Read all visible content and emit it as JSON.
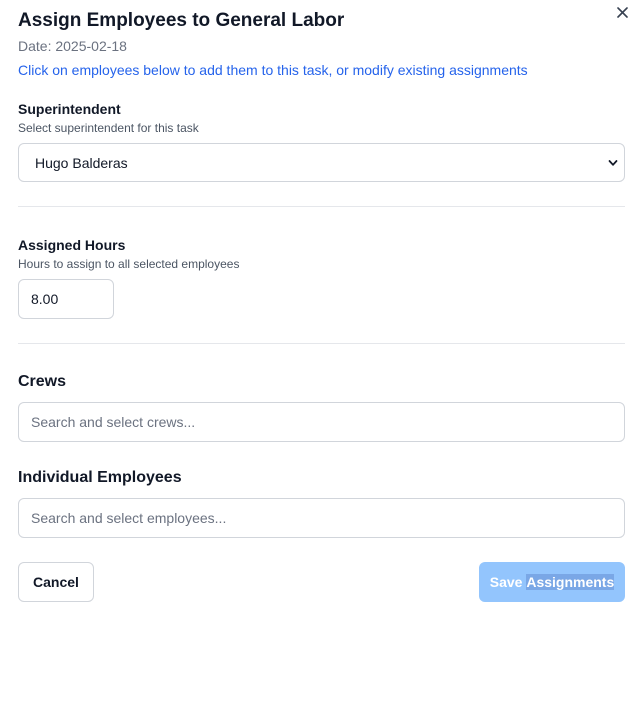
{
  "modal": {
    "title": "Assign Employees to General Labor",
    "date_line": "Date: 2025-02-18",
    "instruction": "Click on employees below to add them to this task, or modify existing assignments",
    "close_icon": "close-icon"
  },
  "superintendent": {
    "label": "Superintendent",
    "help": "Select superintendent for this task",
    "selected": "Hugo Balderas",
    "dropdown_icon": "chevron-down-icon"
  },
  "hours": {
    "label": "Assigned Hours",
    "help": "Hours to assign to all selected employees",
    "value": "8.00"
  },
  "crews": {
    "title": "Crews",
    "placeholder": "Search and select crews..."
  },
  "employees": {
    "title": "Individual Employees",
    "placeholder": "Search and select employees..."
  },
  "footer": {
    "cancel_label": "Cancel",
    "save_label_prefix": "Save ",
    "save_label_selected": "Assignments"
  },
  "colors": {
    "accent_link": "#2563eb",
    "save_disabled_bg": "#93c5fd",
    "border": "#d1d5db"
  }
}
